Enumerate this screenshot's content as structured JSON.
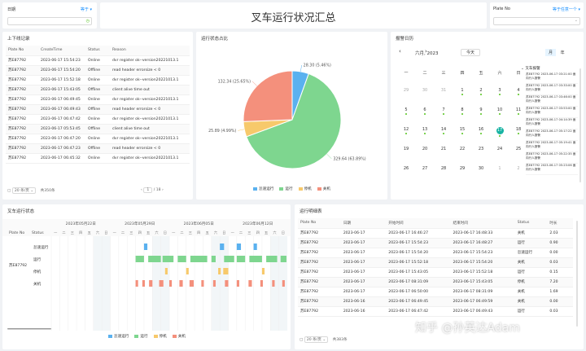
{
  "date_filter": {
    "label": "日期",
    "value": "等于",
    "icon": "calendar-icon"
  },
  "page_title": "叉车运行状况汇总",
  "plate_filter": {
    "label": "Plate No",
    "value": "等于任意一个"
  },
  "log_panel": {
    "title": "上下线记录",
    "columns": [
      "Plate No",
      "CreateTime",
      "Status",
      "Reason"
    ],
    "rows": [
      [
        "苏E87792",
        "2023-06-17 15:54:23",
        "Online",
        "dvr register ok--version20221013.1"
      ],
      [
        "苏E87792",
        "2023-06-17 15:54:20",
        "Offline",
        "read header errorsize < 0"
      ],
      [
        "苏E87792",
        "2023-06-17 15:52:18",
        "Online",
        "dvr register ok--version20221013.1"
      ],
      [
        "苏E87792",
        "2023-06-17 15:43:05",
        "Offline",
        "client alive time out"
      ],
      [
        "苏E87792",
        "2023-06-17 06:49:45",
        "Online",
        "dvr register ok--version20221013.1"
      ],
      [
        "苏E87792",
        "2023-06-17 06:49:43",
        "Offline",
        "read header errorsize < 0"
      ],
      [
        "苏E87792",
        "2023-06-17 06:47:42",
        "Online",
        "dvr register ok--version20221013.1"
      ],
      [
        "苏E87792",
        "2023-06-17 05:53:45",
        "Offline",
        "client alive time out"
      ],
      [
        "苏E87792",
        "2023-06-17 06:47:20",
        "Online",
        "dvr register ok--version20221013.1"
      ],
      [
        "苏E87792",
        "2023-06-17 06:47:23",
        "Offline",
        "read header errorsize < 0"
      ],
      [
        "苏E87792",
        "2023-06-17 06:45:32",
        "Online",
        "dvr register ok--version20221013.1"
      ]
    ],
    "page_size": "20 条/页",
    "total": "共350条",
    "page": "1",
    "pages": "/ 18"
  },
  "pie_panel": {
    "title": "运行状态占比",
    "legend": [
      "怠速运行",
      "运行",
      "停机",
      "关机"
    ],
    "labels": [
      "28.30 (5.46%)",
      "329.64 (63.89%)",
      "25.89 (4.99%)",
      "132.34 (25.65%)"
    ],
    "colors": [
      "#5ab1ef",
      "#7ed68f",
      "#f7c96b",
      "#f4907c"
    ]
  },
  "chart_data": {
    "type": "pie",
    "categories": [
      "怠速运行",
      "运行",
      "停机",
      "关机"
    ],
    "values": [
      28.3,
      329.64,
      25.89,
      132.34
    ],
    "percent": [
      5.46,
      63.89,
      4.99,
      25.65
    ],
    "legend_position": "bottom"
  },
  "calendar": {
    "title": "报警日历",
    "month": "六月, 2023",
    "today_btn": "今天",
    "view_month": "月",
    "view_year": "年",
    "weekdays": [
      "一",
      "二",
      "三",
      "四",
      "五",
      "六",
      "日"
    ],
    "weeks": [
      [
        "29",
        "30",
        "31",
        "1",
        "2",
        "3",
        "4"
      ],
      [
        "5",
        "6",
        "7",
        "8",
        "9",
        "10",
        "11"
      ],
      [
        "12",
        "13",
        "14",
        "15",
        "16",
        "17",
        "18"
      ],
      [
        "19",
        "20",
        "21",
        "22",
        "23",
        "24",
        "25"
      ],
      [
        "26",
        "27",
        "28",
        "29",
        "30",
        "1",
        "2"
      ]
    ],
    "selected": "17",
    "alarm_group": "叉车报警",
    "alarms": [
      "苏E87792 2023-06-17 03:21:00 面向行人报警",
      "苏E87792 2023-06-17 03:33:00 面向行人报警",
      "苏E87792 2023-06-17 03:46:00 面向行人报警",
      "苏E87792 2023-06-17 03:53:00 面向行人报警",
      "苏E87792 2023-06-17 04:14:39 面向行人报警",
      "苏E87792 2023-06-17 05:17:22 面向行人报警",
      "苏E87792 2023-06-17 05:19:41 面向行人报警",
      "苏E87792 2023-06-17 05:22:35 面向行人报警",
      "苏E87792 2023-06-17 05:23:06 面向行人报警"
    ]
  },
  "gantt": {
    "title": "叉车运行状态",
    "col_plate": "Plate No",
    "col_status": "Status",
    "plate": "苏E87792",
    "statuses": [
      "怠速运行",
      "运行",
      "停机",
      "关机"
    ],
    "weeks": [
      "2023年05月22日",
      "2023年05月29日",
      "2023年06月05日",
      "2023年06月12日"
    ],
    "day_letters": [
      "一",
      "二",
      "三",
      "四",
      "五",
      "六",
      "日"
    ],
    "legend": [
      "怠速运行",
      "运行",
      "停机",
      "关机"
    ]
  },
  "detail_panel": {
    "title": "运行明细表",
    "columns": [
      "Plate No",
      "日期",
      "开始时间",
      "结束时间",
      "Status",
      "时长"
    ],
    "rows": [
      [
        "苏E87792",
        "2023-06-17",
        "2023-06-17 16:46:27",
        "2023-06-17 16:48:33",
        "关机",
        "2.03"
      ],
      [
        "苏E87792",
        "2023-06-17",
        "2023-06-17 15:54:23",
        "2023-06-17 16:48:27",
        "运行",
        "0.90"
      ],
      [
        "苏E87792",
        "2023-06-17",
        "2023-06-17 15:54:20",
        "2023-06-17 15:54:23",
        "怠速运行",
        "0.00"
      ],
      [
        "苏E87792",
        "2023-06-17",
        "2023-06-17 15:52:18",
        "2023-06-17 15:54:20",
        "关机",
        "0.03"
      ],
      [
        "苏E87792",
        "2023-06-17",
        "2023-06-17 15:43:05",
        "2023-06-17 15:52:18",
        "运行",
        "0.15"
      ],
      [
        "苏E87792",
        "2023-06-17",
        "2023-06-17 08:31:09",
        "2023-06-17 15:43:05",
        "停机",
        "7.20"
      ],
      [
        "苏E87792",
        "2023-06-17",
        "2023-06-17 06:50:00",
        "2023-06-17 08:31:09",
        "关机",
        "1.69"
      ],
      [
        "苏E87792",
        "2023-06-16",
        "2023-06-17 06:49:45",
        "2023-06-17 06:49:59",
        "关机",
        "0.00"
      ],
      [
        "苏E87792",
        "2023-06-16",
        "2023-06-17 06:47:42",
        "2023-06-17 06:49:43",
        "运行",
        "0.03"
      ]
    ],
    "page_size": "20 条/页",
    "total": "共383条"
  },
  "watermark": "知乎 @孙英达Adam"
}
